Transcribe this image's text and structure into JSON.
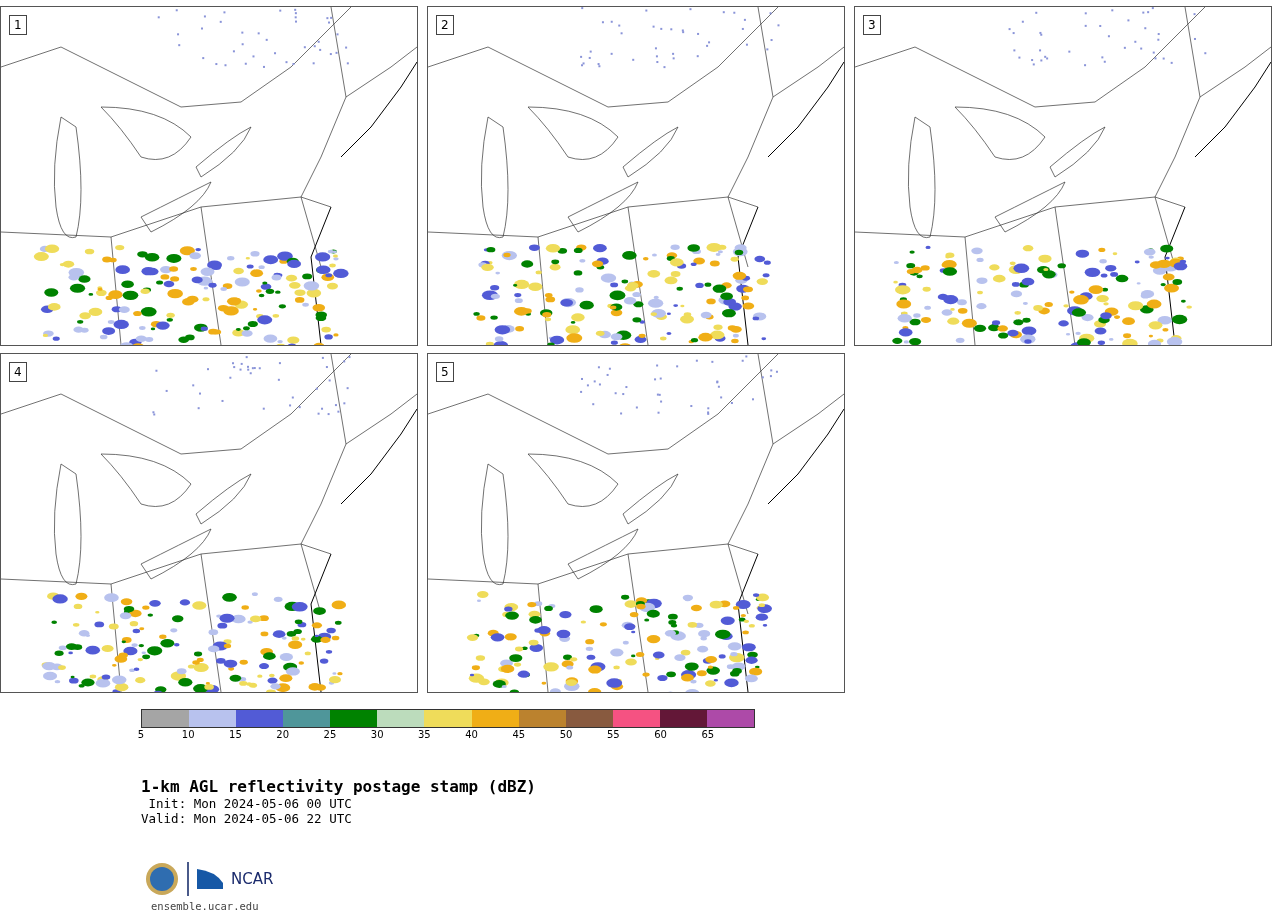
{
  "panels": [
    {
      "label": "1"
    },
    {
      "label": "2"
    },
    {
      "label": "3"
    },
    {
      "label": "4"
    },
    {
      "label": "5"
    }
  ],
  "colorbar": {
    "bins": [
      {
        "color": "#a5a5a5"
      },
      {
        "color": "#b8c2ee"
      },
      {
        "color": "#525bd6"
      },
      {
        "color": "#4f969a"
      },
      {
        "color": "#008200"
      },
      {
        "color": "#bcdcbc"
      },
      {
        "color": "#efdc5a"
      },
      {
        "color": "#f0ae16"
      },
      {
        "color": "#bb822e"
      },
      {
        "color": "#885a3f"
      },
      {
        "color": "#f55282"
      },
      {
        "color": "#631737"
      },
      {
        "color": "#ad4aa8"
      }
    ],
    "ticks": [
      "5",
      "10",
      "15",
      "20",
      "25",
      "30",
      "35",
      "40",
      "45",
      "50",
      "55",
      "60",
      "65"
    ]
  },
  "title": "1-km AGL reflectivity postage stamp (dBZ)",
  "init": " Init: Mon 2024-05-06 00 UTC",
  "valid": "Valid: Mon 2024-05-06 22 UTC",
  "logo": {
    "text": "NCAR",
    "url": "ensemble.ucar.edu"
  }
}
